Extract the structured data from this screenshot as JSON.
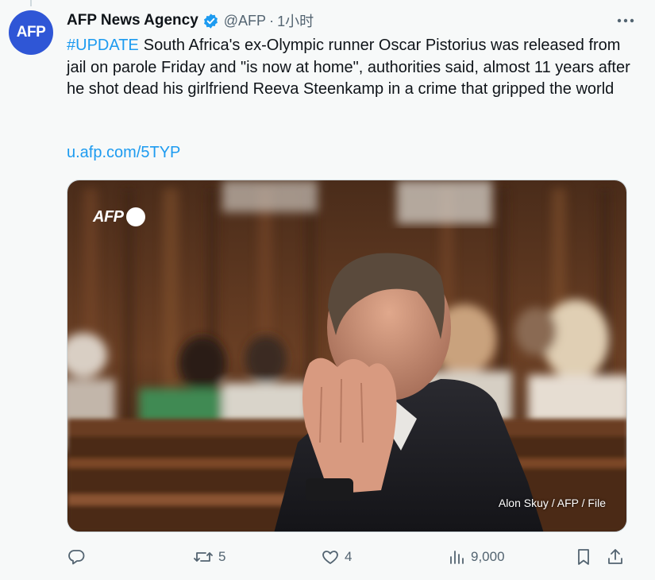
{
  "tweet": {
    "author_name": "AFP News Agency",
    "avatar_text": "AFP",
    "handle": "@AFP",
    "separator": "·",
    "time": "1小时",
    "hashtag": "#UPDATE",
    "text": "South Africa's ex-Olympic runner Oscar Pistorius was released from jail on parole Friday and \"is now at home\", authorities said, almost 11 years after he shot dead his girlfriend Reeva Steenkamp in a crime that gripped the world",
    "link": "u.afp.com/5TYP",
    "media": {
      "watermark": "AFP",
      "credit": "Alon Skuy / AFP / File"
    },
    "actions": {
      "reply_count": "",
      "retweet_count": "5",
      "like_count": "4",
      "view_count": "9,000"
    }
  },
  "icons": {
    "verified": "verified-badge-icon",
    "more": "more-dots-icon",
    "reply": "reply-icon",
    "retweet": "retweet-icon",
    "like": "heart-icon",
    "views": "views-icon",
    "bookmark": "bookmark-icon",
    "share": "share-icon"
  },
  "colors": {
    "accent": "#1d9bf0",
    "avatar_bg": "#2f56d6",
    "text": "#0f1419",
    "muted": "#536471",
    "background": "#f7f9f9"
  }
}
